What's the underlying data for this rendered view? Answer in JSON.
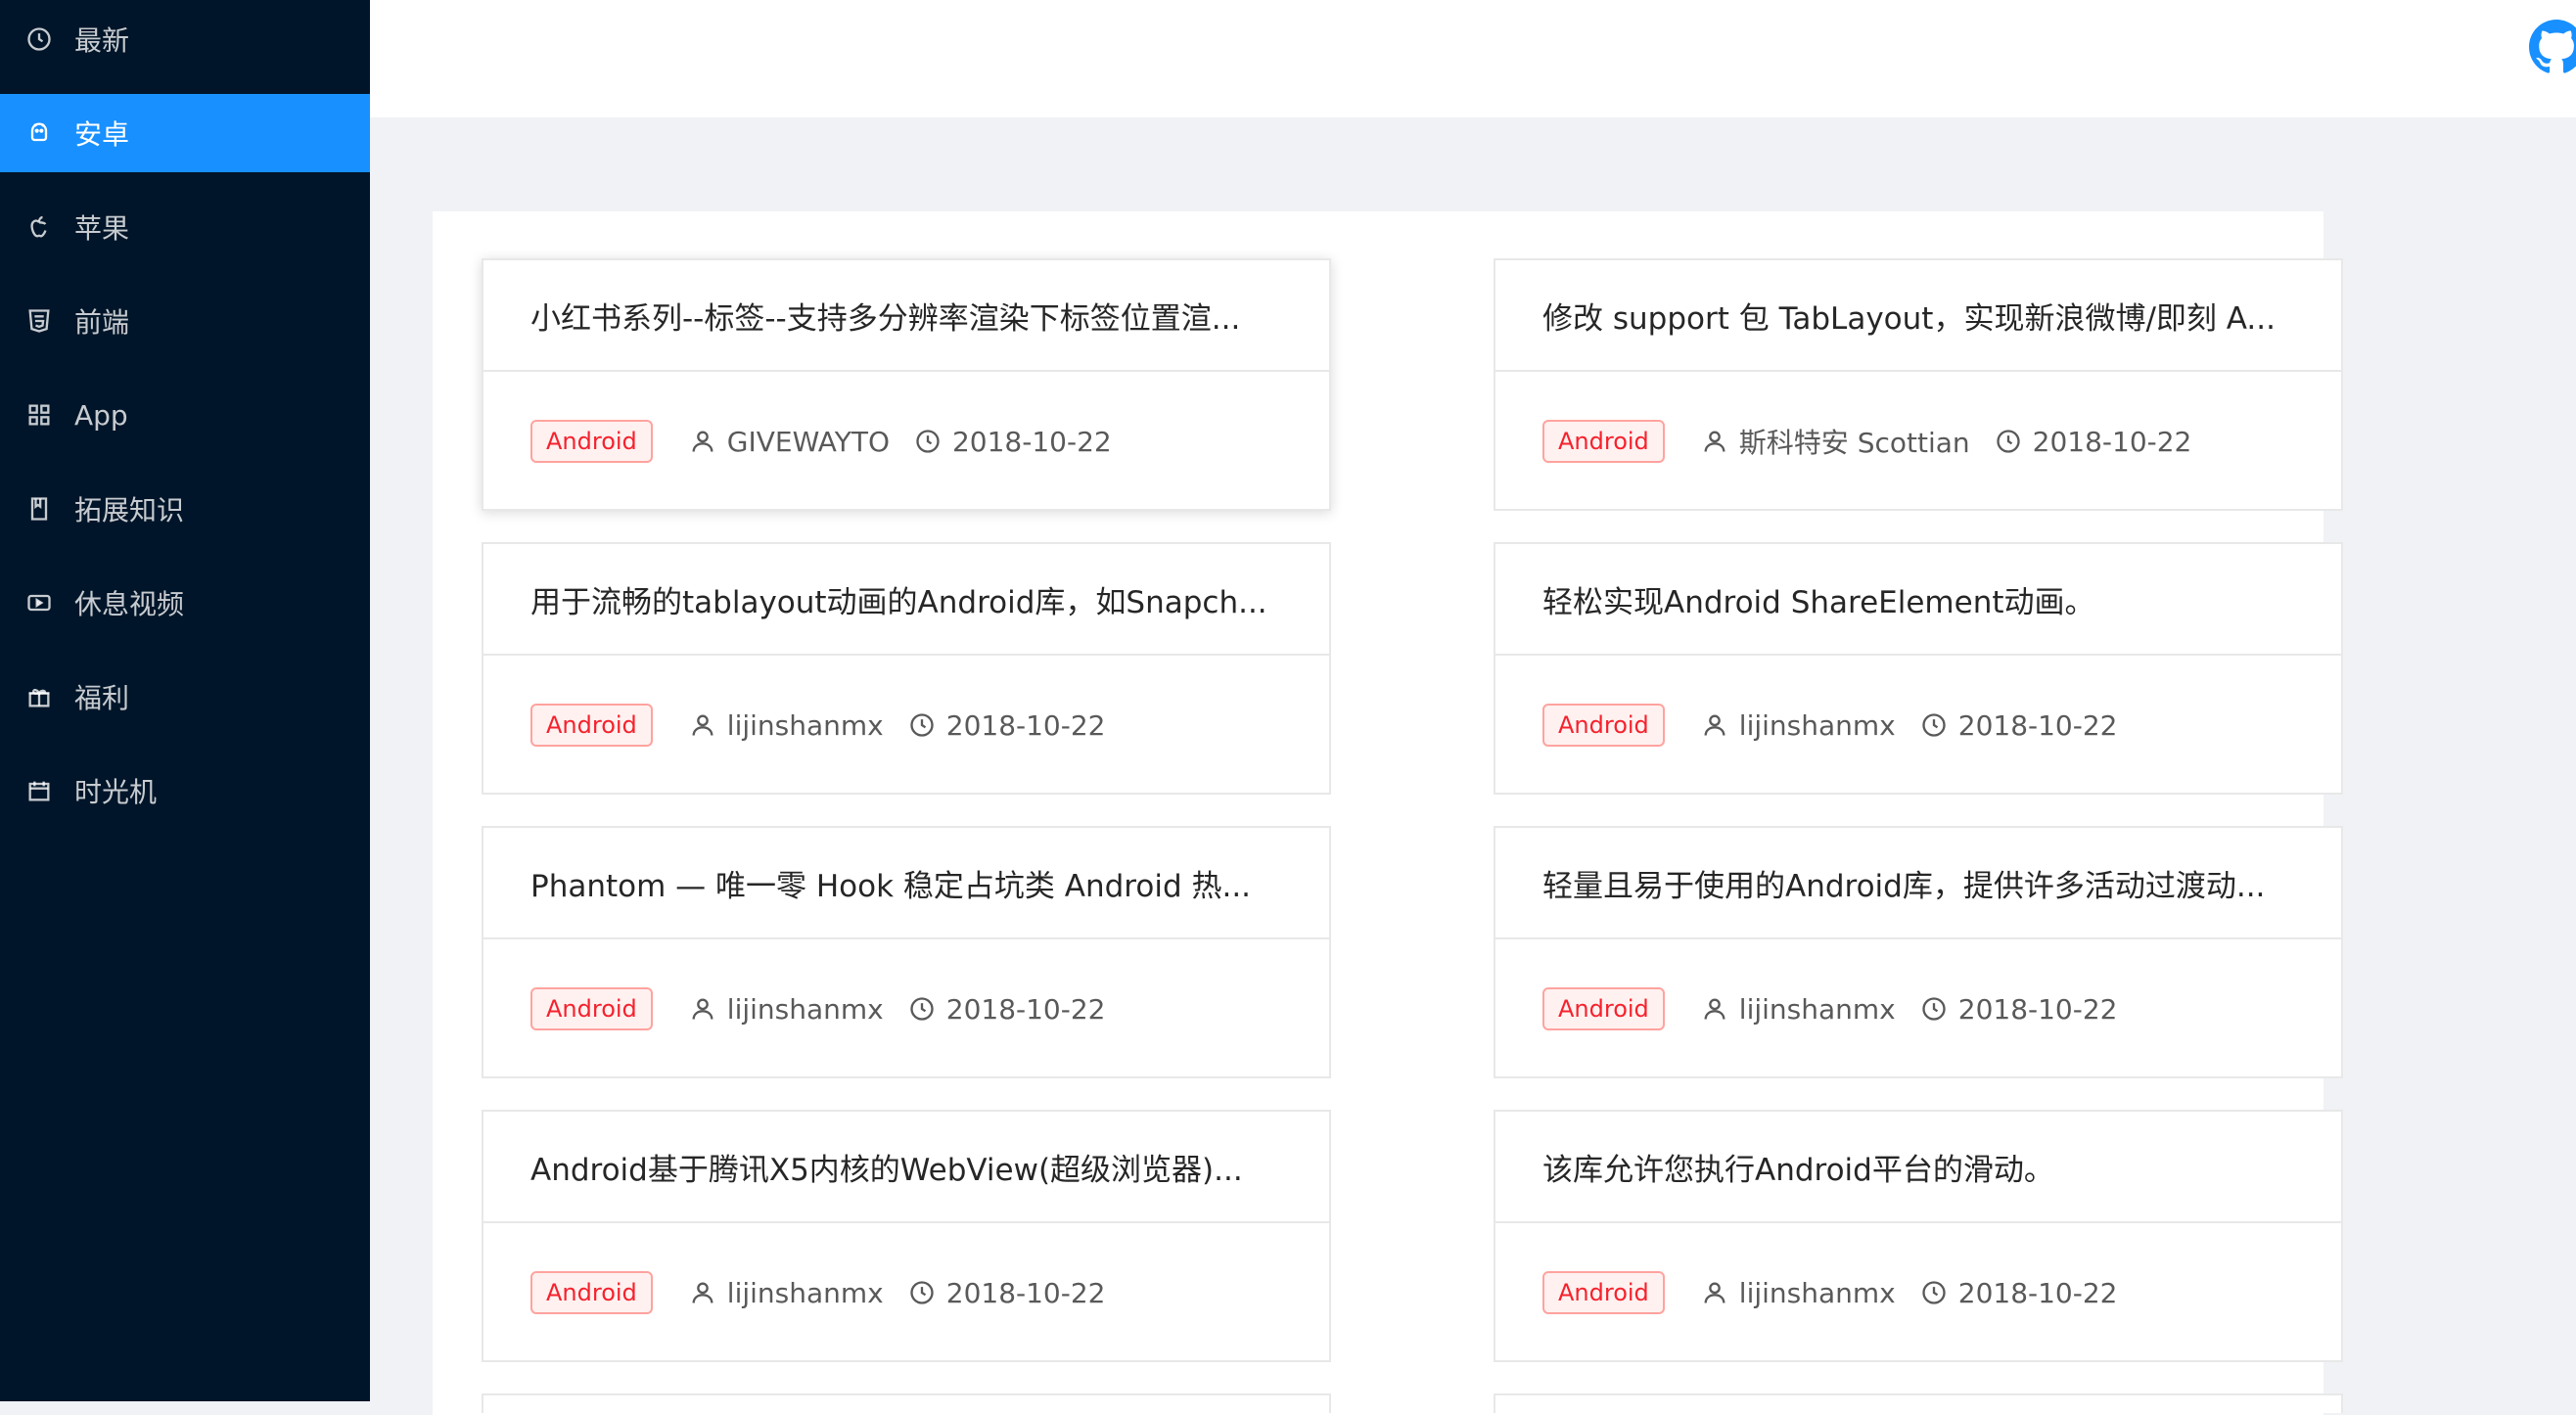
{
  "sidebar": {
    "items": [
      {
        "label": "最新",
        "icon": "clock-icon",
        "active": false
      },
      {
        "label": "安卓",
        "icon": "android-icon",
        "active": true
      },
      {
        "label": "苹果",
        "icon": "apple-icon",
        "active": false
      },
      {
        "label": "前端",
        "icon": "html5-icon",
        "active": false
      },
      {
        "label": "App",
        "icon": "appstore-icon",
        "active": false
      },
      {
        "label": "拓展知识",
        "icon": "book-icon",
        "active": false
      },
      {
        "label": "休息视频",
        "icon": "video-icon",
        "active": false
      },
      {
        "label": "福利",
        "icon": "gift-icon",
        "active": false
      },
      {
        "label": "时光机",
        "icon": "calendar-icon",
        "active": false
      }
    ]
  },
  "header": {
    "icon": "github-icon"
  },
  "colors": {
    "sidebar_bg": "#001529",
    "active_bg": "#1890ff",
    "tag_text": "#f5222d",
    "tag_border": "#ffa39e",
    "tag_bg": "#fff1f0"
  },
  "cards": [
    {
      "title": "小红书系列--标签--支持多分辨率渲染下标签位置渲...",
      "tag": "Android",
      "author": "GIVEWAYTO",
      "date": "2018-10-22"
    },
    {
      "title": "修改 support 包 TabLayout，实现新浪微博/即刻 A...",
      "tag": "Android",
      "author": "斯科特安 Scottian",
      "date": "2018-10-22"
    },
    {
      "title": "用于流畅的tablayout动画的Android库，如Snapch...",
      "tag": "Android",
      "author": "lijinshanmx",
      "date": "2018-10-22"
    },
    {
      "title": "轻松实现Android ShareElement动画。",
      "tag": "Android",
      "author": "lijinshanmx",
      "date": "2018-10-22"
    },
    {
      "title": "Phantom — 唯一零 Hook 稳定占坑类 Android 热...",
      "tag": "Android",
      "author": "lijinshanmx",
      "date": "2018-10-22"
    },
    {
      "title": "轻量且易于使用的Android库，提供许多活动过渡动...",
      "tag": "Android",
      "author": "lijinshanmx",
      "date": "2018-10-22"
    },
    {
      "title": "Android基于腾讯X5内核的WebView(超级浏览器)...",
      "tag": "Android",
      "author": "lijinshanmx",
      "date": "2018-10-22"
    },
    {
      "title": "该库允许您执行Android平台的滑动。",
      "tag": "Android",
      "author": "lijinshanmx",
      "date": "2018-10-22"
    }
  ]
}
